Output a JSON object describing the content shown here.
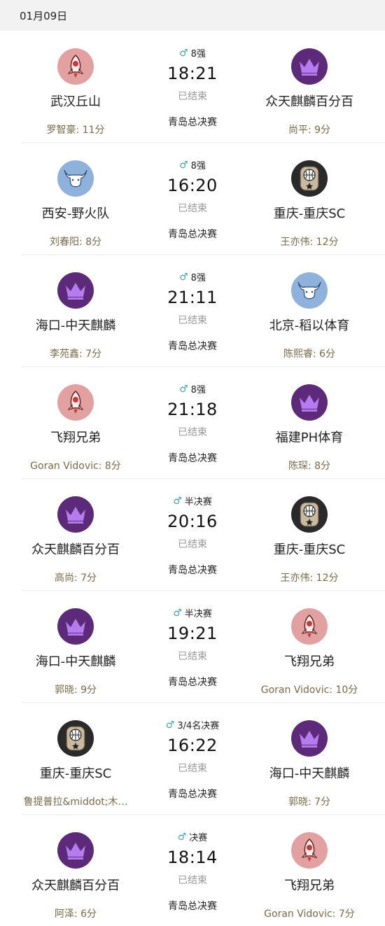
{
  "date": "01月09日",
  "matches": [
    {
      "home": {
        "name": "武汉丘山",
        "logo": "rocket",
        "scorer": "罗智豪: 11分"
      },
      "away": {
        "name": "众天麒麟百分百",
        "logo": "crown",
        "scorer": "尚平: 9分"
      },
      "round": "8强",
      "gender": "♂",
      "time": "18:21",
      "status": "已结束",
      "venue": "青岛总决赛"
    },
    {
      "home": {
        "name": "西安-野火队",
        "logo": "bull",
        "scorer": "刘春阳: 8分"
      },
      "away": {
        "name": "重庆-重庆SC",
        "logo": "ball",
        "scorer": "王亦伟: 12分"
      },
      "round": "8强",
      "gender": "♂",
      "time": "16:20",
      "status": "已结束",
      "venue": "青岛总决赛"
    },
    {
      "home": {
        "name": "海口-中天麒麟",
        "logo": "crown",
        "scorer": "李苑鑫: 7分"
      },
      "away": {
        "name": "北京-稻以体育",
        "logo": "bull",
        "scorer": "陈熙睿: 6分"
      },
      "round": "8强",
      "gender": "♂",
      "time": "21:11",
      "status": "已结束",
      "venue": "青岛总决赛"
    },
    {
      "home": {
        "name": "飞翔兄弟",
        "logo": "rocket",
        "scorer": "Goran Vidovic: 8分"
      },
      "away": {
        "name": "福建PH体育",
        "logo": "crown",
        "scorer": "陈琛: 8分"
      },
      "round": "8强",
      "gender": "♂",
      "time": "21:18",
      "status": "已结束",
      "venue": "青岛总决赛"
    },
    {
      "home": {
        "name": "众天麒麟百分百",
        "logo": "crown",
        "scorer": "高尚: 7分"
      },
      "away": {
        "name": "重庆-重庆SC",
        "logo": "ball",
        "scorer": "王亦伟: 12分"
      },
      "round": "半决赛",
      "gender": "♂",
      "time": "20:16",
      "status": "已结束",
      "venue": "青岛总决赛"
    },
    {
      "home": {
        "name": "海口-中天麒麟",
        "logo": "crown",
        "scorer": "郭晓: 9分"
      },
      "away": {
        "name": "飞翔兄弟",
        "logo": "rocket",
        "scorer": "Goran Vidovic: 10分"
      },
      "round": "半决赛",
      "gender": "♂",
      "time": "19:21",
      "status": "已结束",
      "venue": "青岛总决赛"
    },
    {
      "home": {
        "name": "重庆-重庆SC",
        "logo": "ball",
        "scorer": "鲁提普拉&middot;木…"
      },
      "away": {
        "name": "海口-中天麒麟",
        "logo": "crown",
        "scorer": "郭晓: 7分"
      },
      "round": "3/4名决赛",
      "gender": "♂",
      "time": "16:22",
      "status": "已结束",
      "venue": "青岛总决赛"
    },
    {
      "home": {
        "name": "众天麒麟百分百",
        "logo": "crown",
        "scorer": "阿泽: 6分"
      },
      "away": {
        "name": "飞翔兄弟",
        "logo": "rocket",
        "scorer": "Goran Vidovic: 7分"
      },
      "round": "决赛",
      "gender": "♂",
      "time": "18:14",
      "status": "已结束",
      "venue": "青岛总决赛"
    }
  ]
}
